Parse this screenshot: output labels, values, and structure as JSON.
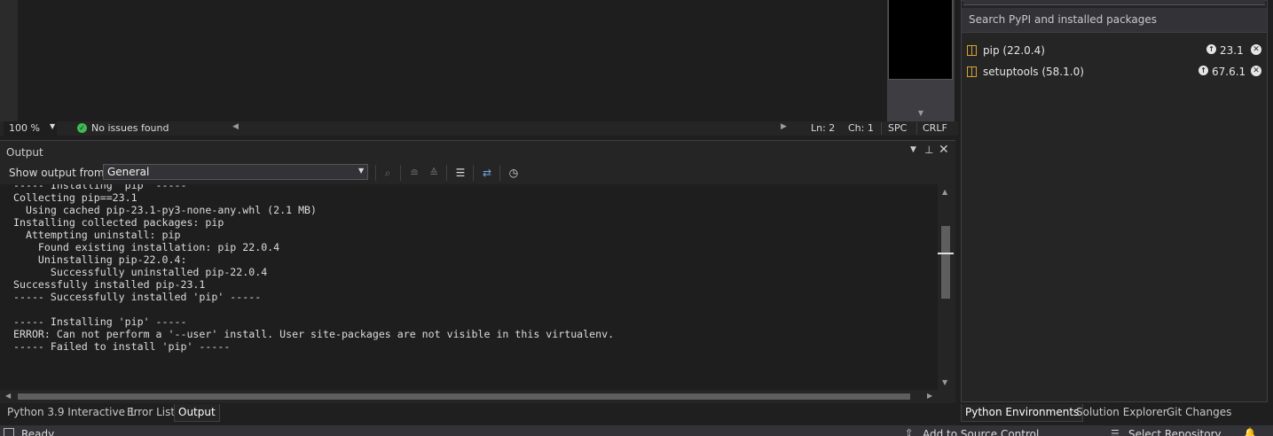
{
  "editor": {
    "zoom": "100 %",
    "issues": "No issues found",
    "line": "Ln: 2",
    "char": "Ch: 1",
    "whitespace": "SPC",
    "line_ending": "CRLF"
  },
  "output": {
    "title": "Output",
    "show_from_label": "Show output from:",
    "source": "General",
    "lines": [
      "----- Installing 'pip' -----",
      "Collecting pip==23.1",
      "  Using cached pip-23.1-py3-none-any.whl (2.1 MB)",
      "Installing collected packages: pip",
      "  Attempting uninstall: pip",
      "    Found existing installation: pip 22.0.4",
      "    Uninstalling pip-22.0.4:",
      "      Successfully uninstalled pip-22.0.4",
      "Successfully installed pip-23.1",
      "----- Successfully installed 'pip' -----",
      "",
      "----- Installing 'pip' -----",
      "ERROR: Can not perform a '--user' install. User site-packages are not visible in this virtualenv.",
      "----- Failed to install 'pip' -----"
    ]
  },
  "bottom_tabs": [
    {
      "label": "Python 3.9 Interactive 1"
    },
    {
      "label": "Error List"
    },
    {
      "label": "Output"
    }
  ],
  "packages": {
    "search_placeholder": "Search PyPI and installed packages",
    "items": [
      {
        "name": "pip (22.0.4)",
        "upgrade": "23.1"
      },
      {
        "name": "setuptools (58.1.0)",
        "upgrade": "67.6.1"
      }
    ]
  },
  "right_tabs": [
    {
      "label": "Python Environments"
    },
    {
      "label": "Solution Explorer"
    },
    {
      "label": "Git Changes"
    }
  ],
  "status": {
    "ready": "Ready",
    "add_source_control": "Add to Source Control",
    "select_repository": "Select Repository"
  },
  "colors": {
    "background": "#1f1f1f",
    "panel": "#252526",
    "editor": "#1e1e1e",
    "success": "#3fb950",
    "package_icon": "#d8a330"
  }
}
